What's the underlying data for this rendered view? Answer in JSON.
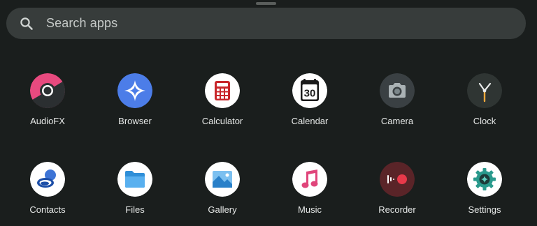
{
  "search": {
    "placeholder": "Search apps"
  },
  "apps": [
    {
      "label": "AudioFX",
      "icon": "audiofx-icon",
      "color": "#e84a7f"
    },
    {
      "label": "Browser",
      "icon": "browser-icon",
      "color": "#4c7de8"
    },
    {
      "label": "Calculator",
      "icon": "calculator-icon",
      "color": "#c8262a"
    },
    {
      "label": "Calendar",
      "icon": "calendar-icon",
      "date": "30",
      "color": "#1a1a1a"
    },
    {
      "label": "Camera",
      "icon": "camera-icon",
      "color": "#3a4043"
    },
    {
      "label": "Clock",
      "icon": "clock-icon",
      "color": "#2f3533"
    },
    {
      "label": "Contacts",
      "icon": "contacts-icon",
      "color": "#3d74d6"
    },
    {
      "label": "Files",
      "icon": "files-icon",
      "color": "#2f8fd8"
    },
    {
      "label": "Gallery",
      "icon": "gallery-icon",
      "color": "#2980c9"
    },
    {
      "label": "Music",
      "icon": "music-icon",
      "color": "#e0457b"
    },
    {
      "label": "Recorder",
      "icon": "recorder-icon",
      "color": "#d9323f"
    },
    {
      "label": "Settings",
      "icon": "settings-icon",
      "color": "#2a9a8d"
    }
  ]
}
